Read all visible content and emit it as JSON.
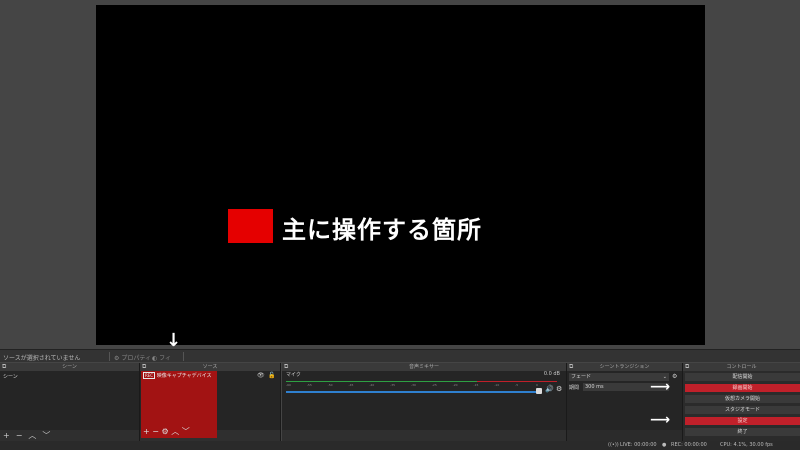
{
  "annotation": {
    "label": "主に操作する箇所"
  },
  "source_toolbar": {
    "no_source": "ソースが選択されていません",
    "properties": "プロパティ",
    "filters": "フィ"
  },
  "scenes": {
    "title": "シーン",
    "items": [
      "シーン"
    ]
  },
  "sources": {
    "title": "ソース",
    "items": [
      "映像キャプチャデバイス"
    ]
  },
  "mixer": {
    "title": "音声ミキサー",
    "track_name": "マイク",
    "track_level": "0.0 dB",
    "ticks": [
      "-60",
      "-55",
      "-50",
      "-45",
      "-40",
      "-35",
      "-30",
      "-25",
      "-20",
      "-15",
      "-10",
      "-5",
      "0"
    ]
  },
  "transitions": {
    "title": "シーントランジション",
    "type": "フェード",
    "duration_label": "期間",
    "duration_value": "300 ms"
  },
  "controls": {
    "title": "コントロール",
    "start_streaming": "配信開始",
    "start_recording": "録画開始",
    "virtual_camera": "仮想カメラ開始",
    "studio_mode": "スタジオモード",
    "settings": "設定",
    "exit": "終了"
  },
  "status": {
    "live": "LIVE: 00:00:00",
    "rec": "REC: 00:00:00",
    "cpu": "CPU: 4.1%, 30.00 fps"
  },
  "colors": {
    "highlight": "#e50000",
    "button_red": "#c0202a"
  }
}
